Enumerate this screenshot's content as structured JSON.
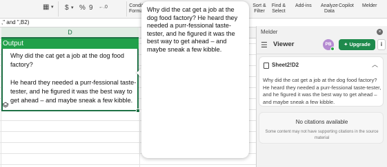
{
  "ribbon": {
    "icons": [
      "table-icon",
      "currency-icon",
      "percent-icon",
      "comma-icon",
      "decimal-icon"
    ],
    "currency": "$",
    "percent": "%",
    "comma": "9",
    "decimal": "←.0",
    "conditional_formatting": [
      "Conditi",
      "Format"
    ],
    "sort_filter": [
      "Sort &",
      "Filter"
    ],
    "find_select": [
      "Find &",
      "Select"
    ],
    "add_ins": "Add-ins",
    "analyze_data": [
      "Analyze",
      "Data"
    ],
    "copilot": "Copilot",
    "melder": "Melder"
  },
  "formula_bar": {
    "text": ",\" and \",B2)"
  },
  "sheet": {
    "column_label": "D",
    "output_header": "Output",
    "cell_paragraphs": [
      "Why did the cat get a job at the dog food factory?",
      "He heard they needed a purr-fessional taste-tester, and he figured it was the best way to get ahead – and maybe sneak a few kibble."
    ]
  },
  "tooltip": {
    "text": "Why did the cat get a job at the dog food factory? He heard they needed a purr-fessional taste-tester, and he figured it was the best way to get ahead – and maybe sneak a few kibble."
  },
  "panel": {
    "title": "Melder",
    "close": "×",
    "view_label": "Viewer",
    "avatar_initials": "PB",
    "upgrade_label": "Upgrade",
    "info": "i",
    "reference": {
      "cell": "Sheet2!D2",
      "text": "Why did the cat get a job at the dog food factory? He heard they needed a purr-fessional taste-tester, and he figured it was the best way to get ahead – and maybe sneak a few kibble."
    },
    "no_citations": {
      "title": "No citations available",
      "subtitle": "Some content may not have supporting citations in the source material"
    },
    "colors": {
      "upgrade": "#1e8a4c",
      "avatar": "#b58bd1",
      "output_header": "#21a04a"
    }
  }
}
